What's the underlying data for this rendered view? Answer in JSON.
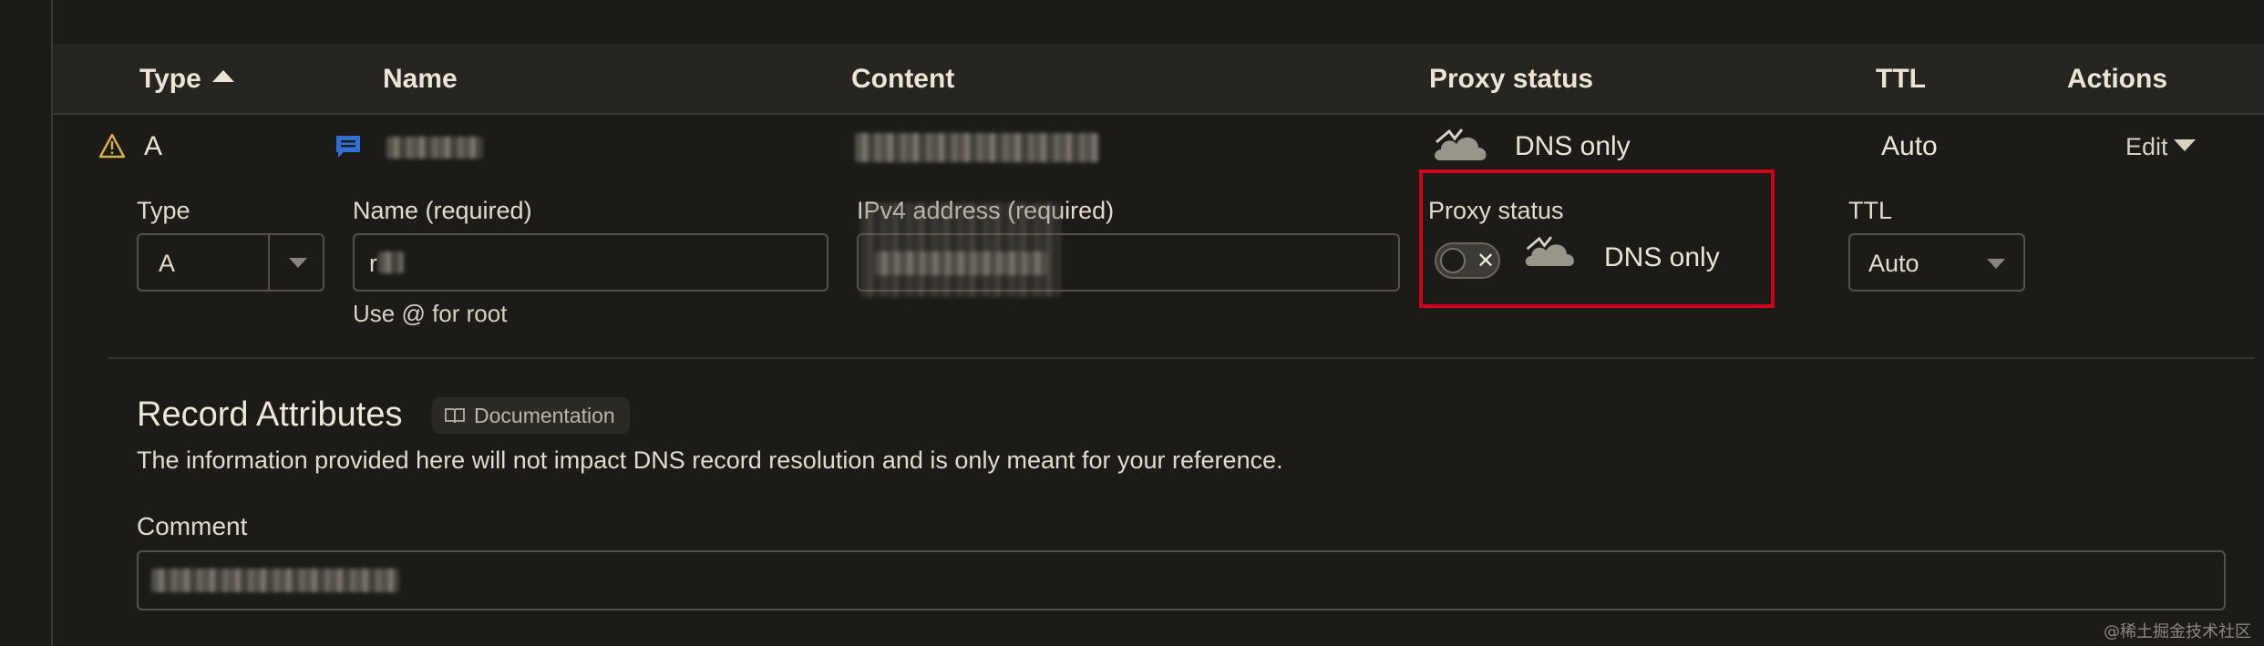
{
  "table": {
    "headers": {
      "type": "Type",
      "name": "Name",
      "content": "Content",
      "proxy_status": "Proxy status",
      "ttl": "TTL",
      "actions": "Actions"
    },
    "sort": {
      "column": "Type",
      "direction": "ascending",
      "icon": "caret-up-icon"
    }
  },
  "record": {
    "type": "A",
    "warning_icon": "warning-triangle-icon",
    "comment_icon": "comment-icon",
    "proxy_status": "DNS only",
    "proxy_icon": "cloud-dns-only-icon",
    "ttl": "Auto",
    "edit_label": "Edit"
  },
  "edit_form": {
    "type_label": "Type",
    "type_value": "A",
    "name_label": "Name (required)",
    "name_value": "r",
    "name_helper": "Use @ for root",
    "ipv4_label": "IPv4 address (required)",
    "proxy_label": "Proxy status",
    "proxy_value": "DNS only",
    "proxy_toggle_on": false,
    "ttl_label": "TTL",
    "ttl_value": "Auto"
  },
  "attributes": {
    "title": "Record Attributes",
    "doc_label": "Documentation",
    "doc_icon": "book-icon",
    "description": "The information provided here will not impact DNS record resolution and is only meant for your reference.",
    "comment_label": "Comment"
  },
  "watermark": "@稀土掘金技术社区",
  "colors": {
    "background": "#1c1b18",
    "header_bg": "#262520",
    "highlight_border": "#d0021b",
    "comment_icon": "#2f6fd6"
  }
}
